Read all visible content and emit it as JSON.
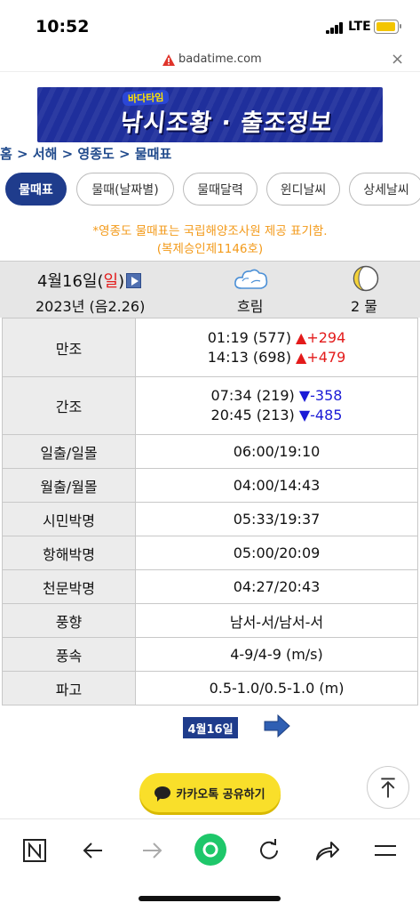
{
  "status_bar": {
    "time": "10:52",
    "network": "LTE"
  },
  "browser": {
    "url": "badatime.com",
    "close_label": "×"
  },
  "banner": {
    "tag": "바다타임",
    "headline": "낚시조황 · 출조정보"
  },
  "breadcrumb": "홈 > 서해 > 영종도 > 물때표",
  "tabs": [
    {
      "label": "물때표"
    },
    {
      "label": "물때(날짜별)"
    },
    {
      "label": "물때달력"
    },
    {
      "label": "윈디날씨"
    },
    {
      "label": "상세날씨"
    }
  ],
  "notice": {
    "line1": "*영종도 물때표는 국립해양조사원 제공 표기함.",
    "line2": "(복제승인제1146호)"
  },
  "header": {
    "date_prefix": "4월16일(",
    "day": "일",
    "date_suffix": ")",
    "lunar": "2023년 (음2.26)",
    "weather": "흐림",
    "tide_phase": "2 물"
  },
  "rows": {
    "high_tide": {
      "label": "만조",
      "entries": [
        {
          "time": "01:19 (577)",
          "change": "▲+294"
        },
        {
          "time": "14:13 (698)",
          "change": "▲+479"
        }
      ]
    },
    "low_tide": {
      "label": "간조",
      "entries": [
        {
          "time": "07:34 (219)",
          "change": "▼-358"
        },
        {
          "time": "20:45 (213)",
          "change": "▼-485"
        }
      ]
    },
    "sun": {
      "label": "일출/일몰",
      "value": "06:00/19:10"
    },
    "moon": {
      "label": "월출/월몰",
      "value": "04:00/14:43"
    },
    "civil": {
      "label": "시민박명",
      "value": "05:33/19:37"
    },
    "nautical": {
      "label": "항해박명",
      "value": "05:00/20:09"
    },
    "astro": {
      "label": "천문박명",
      "value": "04:27/20:43"
    },
    "wind_dir": {
      "label": "풍향",
      "value": "남서-서/남서-서"
    },
    "wind_speed": {
      "label": "풍속",
      "value": "4-9/4-9 (m/s)"
    },
    "wave": {
      "label": "파고",
      "value": "0.5-1.0/0.5-1.0 (m)"
    }
  },
  "next": {
    "date_label": "4월16일"
  },
  "share": {
    "kakao_label": "카카오톡 공유하기"
  },
  "colors": {
    "accent": "#1f3c8c",
    "notice": "#f39a1a",
    "up": "#e31b1b",
    "down": "#1a1ad6",
    "kakao": "#f9df2a"
  }
}
